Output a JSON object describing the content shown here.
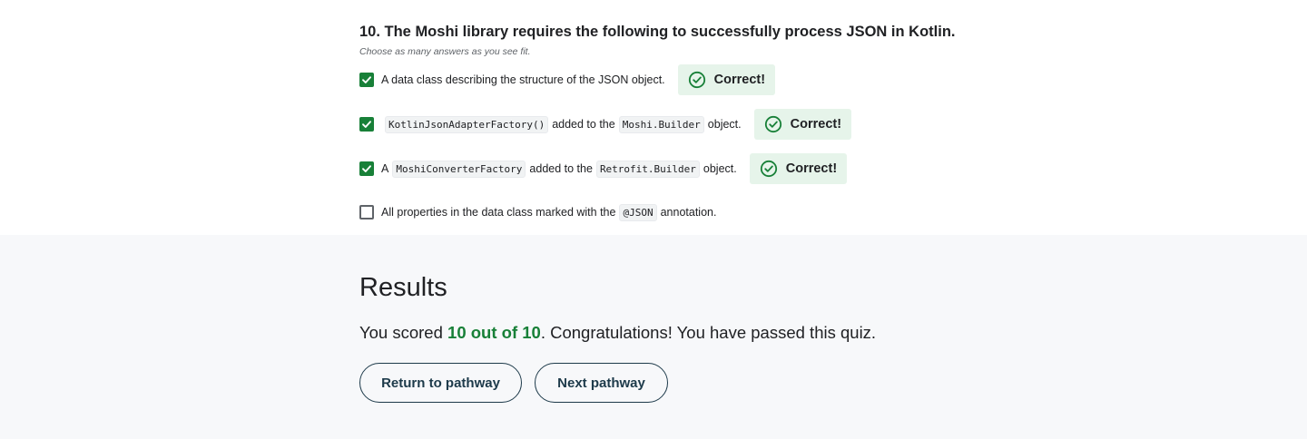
{
  "question": {
    "title": "10. The Moshi library requires the following to successfully process JSON in Kotlin.",
    "hint": "Choose as many answers as you see fit.",
    "options": [
      {
        "checked": true,
        "segments": [
          {
            "type": "text",
            "value": "A data class describing the structure of the JSON object."
          }
        ],
        "feedback": "Correct!"
      },
      {
        "checked": true,
        "segments": [
          {
            "type": "code",
            "value": "KotlinJsonAdapterFactory()"
          },
          {
            "type": "text",
            "value": "added to the"
          },
          {
            "type": "code",
            "value": "Moshi.Builder"
          },
          {
            "type": "text",
            "value": "object."
          }
        ],
        "feedback": "Correct!"
      },
      {
        "checked": true,
        "segments": [
          {
            "type": "text",
            "value": "A"
          },
          {
            "type": "code",
            "value": "MoshiConverterFactory"
          },
          {
            "type": "text",
            "value": "added to the"
          },
          {
            "type": "code",
            "value": "Retrofit.Builder"
          },
          {
            "type": "text",
            "value": "object."
          }
        ],
        "feedback": "Correct!"
      },
      {
        "checked": false,
        "segments": [
          {
            "type": "text",
            "value": "All properties in the data class marked with the"
          },
          {
            "type": "code",
            "value": "@JSON"
          },
          {
            "type": "text",
            "value": "annotation."
          }
        ],
        "feedback": null
      }
    ]
  },
  "results": {
    "title": "Results",
    "prefix": "You scored ",
    "score": "10 out of 10",
    "suffix": ". Congratulations! You have passed this quiz.",
    "buttons": {
      "return_label": "Return to pathway",
      "next_label": "Next pathway"
    }
  },
  "colors": {
    "correct_green": "#188038",
    "badge_bg": "#e6f4ea",
    "button_border": "#1d3a4a",
    "results_bg": "#f7f8fa"
  },
  "icons": {
    "checkbox_checked": "check-icon",
    "feedback": "check-circle-icon"
  }
}
